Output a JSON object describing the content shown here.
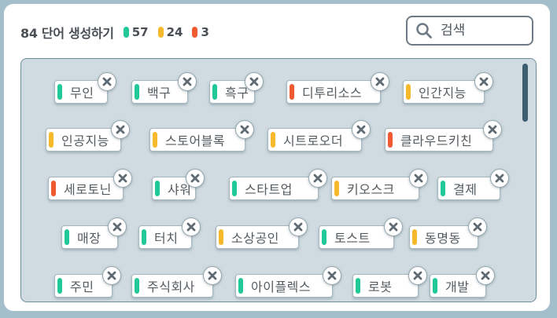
{
  "header": {
    "title": "84 단어 생성하기",
    "counts": [
      {
        "color": "#20c997",
        "value": "57"
      },
      {
        "color": "#f6b92b",
        "value": "24"
      },
      {
        "color": "#ef5a32",
        "value": "3"
      }
    ]
  },
  "search": {
    "placeholder": "검색",
    "value": ""
  },
  "colors": {
    "green": "#20c997",
    "yellow": "#f6b92b",
    "red": "#ef5a32"
  },
  "rows": [
    [
      {
        "label": "무인",
        "color": "green"
      },
      {
        "label": "백구",
        "color": "green"
      },
      {
        "label": "흑구",
        "color": "green"
      },
      {
        "label": "디투리소스",
        "color": "red"
      },
      {
        "label": "인간지능",
        "color": "yellow"
      }
    ],
    [
      {
        "label": "인공지능",
        "color": "yellow"
      },
      {
        "label": "스토어블록",
        "color": "yellow"
      },
      {
        "label": "시트로오더",
        "color": "yellow"
      },
      {
        "label": "클라우드키친",
        "color": "red"
      }
    ],
    [
      {
        "label": "세로토닌",
        "color": "red"
      },
      {
        "label": "샤워",
        "color": "green"
      },
      {
        "label": "스타트업",
        "color": "green"
      },
      {
        "label": "키오스크",
        "color": "yellow"
      },
      {
        "label": "결제",
        "color": "green"
      }
    ],
    [
      {
        "label": "매장",
        "color": "green"
      },
      {
        "label": "터치",
        "color": "green"
      },
      {
        "label": "소상공인",
        "color": "yellow"
      },
      {
        "label": "토스트",
        "color": "green"
      },
      {
        "label": "동명동",
        "color": "yellow"
      }
    ],
    [
      {
        "label": "주민",
        "color": "green"
      },
      {
        "label": "주식회사",
        "color": "green"
      },
      {
        "label": "아이플렉스",
        "color": "green"
      },
      {
        "label": "로봇",
        "color": "green"
      },
      {
        "label": "개발",
        "color": "green"
      }
    ]
  ]
}
